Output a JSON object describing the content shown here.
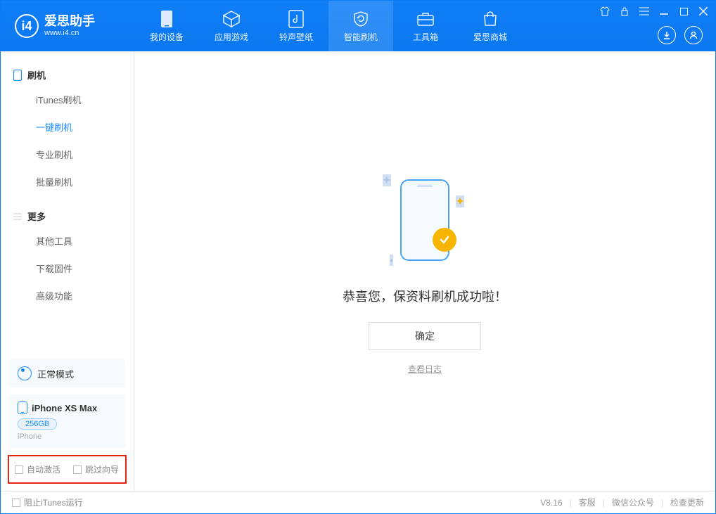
{
  "app": {
    "title": "爱思助手",
    "subtitle": "www.i4.cn"
  },
  "nav": {
    "tabs": [
      {
        "label": "我的设备"
      },
      {
        "label": "应用游戏"
      },
      {
        "label": "铃声壁纸"
      },
      {
        "label": "智能刷机"
      },
      {
        "label": "工具箱"
      },
      {
        "label": "爱思商城"
      }
    ]
  },
  "sidebar": {
    "section1": "刷机",
    "items1": [
      {
        "label": "iTunes刷机"
      },
      {
        "label": "一键刷机"
      },
      {
        "label": "专业刷机"
      },
      {
        "label": "批量刷机"
      }
    ],
    "section2": "更多",
    "items2": [
      {
        "label": "其他工具"
      },
      {
        "label": "下载固件"
      },
      {
        "label": "高级功能"
      }
    ],
    "mode_label": "正常模式",
    "device_name": "iPhone XS Max",
    "storage": "256GB",
    "device_type": "iPhone",
    "chk_auto_activate": "自动激活",
    "chk_skip_wizard": "跳过向导"
  },
  "main": {
    "success_text": "恭喜您，保资料刷机成功啦！",
    "confirm_label": "确定",
    "view_log_label": "查看日志"
  },
  "footer": {
    "block_itunes": "阻止iTunes运行",
    "version": "V8.16",
    "link_support": "客服",
    "link_wechat": "微信公众号",
    "link_update": "检查更新"
  }
}
